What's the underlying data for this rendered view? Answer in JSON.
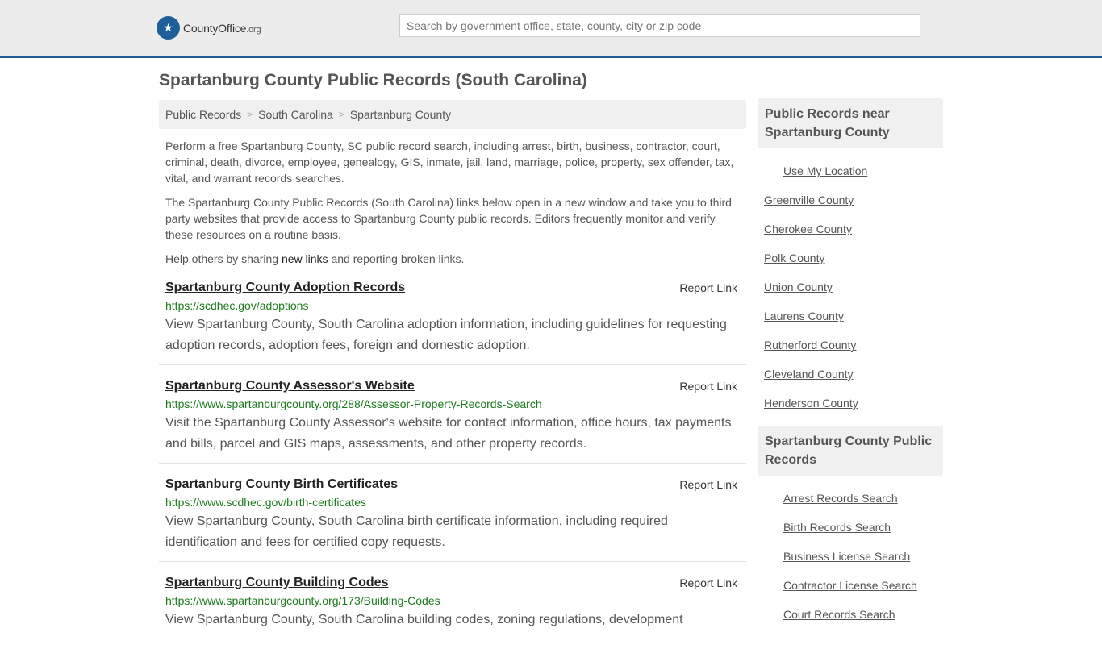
{
  "header": {
    "logo_name": "CountyOffice",
    "logo_suffix": ".org",
    "search_placeholder": "Search by government office, state, county, city or zip code"
  },
  "page_title": "Spartanburg County Public Records (South Carolina)",
  "breadcrumb": [
    "Public Records",
    "South Carolina",
    "Spartanburg County"
  ],
  "intro": {
    "p1": "Perform a free Spartanburg County, SC public record search, including arrest, birth, business, contractor, court, criminal, death, divorce, employee, genealogy, GIS, inmate, jail, land, marriage, police, property, sex offender, tax, vital, and warrant records searches.",
    "p2": "The Spartanburg County Public Records (South Carolina) links below open in a new window and take you to third party websites that provide access to Spartanburg County public records. Editors frequently monitor and verify these resources on a routine basis.",
    "p3_before": "Help others by sharing ",
    "p3_link": "new links",
    "p3_after": " and reporting broken links."
  },
  "records": [
    {
      "title": "Spartanburg County Adoption Records",
      "report": "Report Link",
      "url": "https://scdhec.gov/adoptions",
      "desc": "View Spartanburg County, South Carolina adoption information, including guidelines for requesting adoption records, adoption fees, foreign and domestic adoption."
    },
    {
      "title": "Spartanburg County Assessor's Website",
      "report": "Report Link",
      "url": "https://www.spartanburgcounty.org/288/Assessor-Property-Records-Search",
      "desc": "Visit the Spartanburg County Assessor's website for contact information, office hours, tax payments and bills, parcel and GIS maps, assessments, and other property records."
    },
    {
      "title": "Spartanburg County Birth Certificates",
      "report": "Report Link",
      "url": "https://www.scdhec.gov/birth-certificates",
      "desc": "View Spartanburg County, South Carolina birth certificate information, including required identification and fees for certified copy requests."
    },
    {
      "title": "Spartanburg County Building Codes",
      "report": "Report Link",
      "url": "https://www.spartanburgcounty.org/173/Building-Codes",
      "desc": "View Spartanburg County, South Carolina building codes, zoning regulations, development"
    }
  ],
  "sidebar": {
    "near_heading": "Public Records near Spartanburg County",
    "use_location": "Use My Location",
    "near_counties": [
      "Greenville County",
      "Cherokee County",
      "Polk County",
      "Union County",
      "Laurens County",
      "Rutherford County",
      "Cleveland County",
      "Henderson County"
    ],
    "records_heading": "Spartanburg County Public Records",
    "record_searches": [
      "Arrest Records Search",
      "Birth Records Search",
      "Business License Search",
      "Contractor License Search",
      "Court Records Search"
    ]
  }
}
